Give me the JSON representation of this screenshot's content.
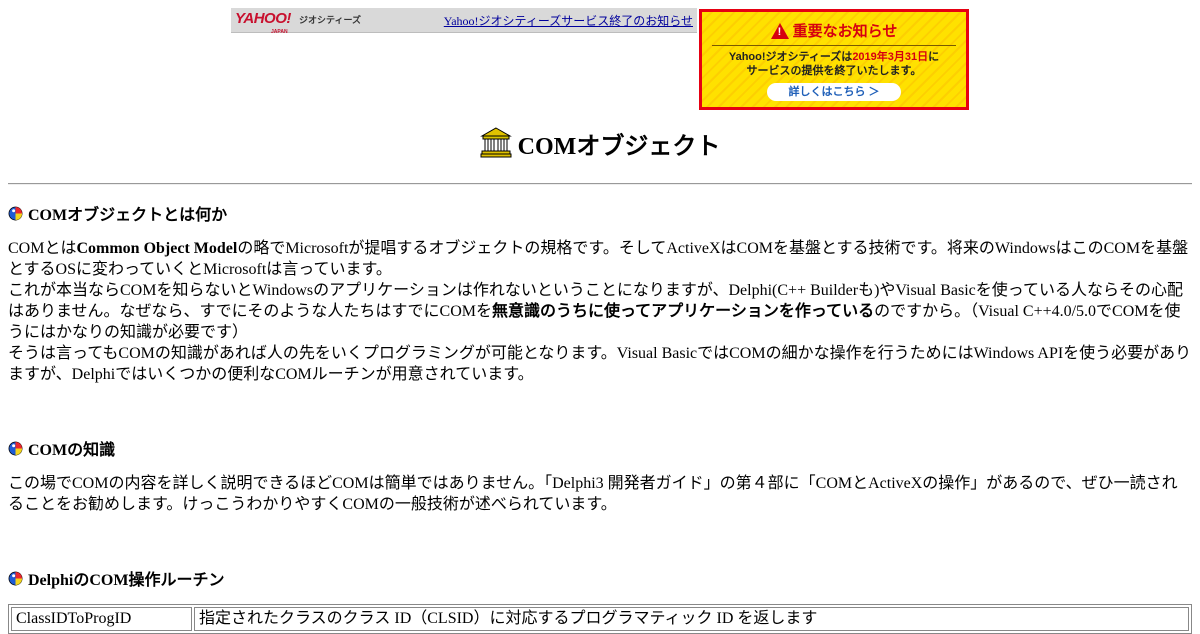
{
  "banner": {
    "yahoo_logo": "YAHOO!",
    "yahoo_japan": "JAPAN",
    "geo_label": "ジオシティーズ",
    "link_text": "Yahoo!ジオシティーズサービス終了のお知らせ"
  },
  "notice": {
    "title": "重要なお知らせ",
    "line1_prefix": "Yahoo!ジオシティーズは",
    "line1_date": "2019年3月31日",
    "line1_suffix": "に",
    "line2": "サービスの提供を終了いたします。",
    "button": "詳しくはこちら ＞",
    "colors": {
      "background": "#ffe100",
      "border": "#e60012",
      "accent": "#d60010"
    }
  },
  "page": {
    "title": "COMオブジェクト",
    "title_icon": "bank-building-icon"
  },
  "sections": [
    {
      "heading": "COMオブジェクトとは何か",
      "icon": "colored-ball-icon",
      "paragraphs": [
        {
          "a": "COMとは",
          "b": "Common Object Model",
          "c": "の略でMicrosoftが提唱するオブジェクトの規格です。そしてActiveXはCOMを基盤とする技術です。将来のWindowsはこのCOMを基盤とするOSに変わっていくとMicrosoftは言っています。"
        },
        {
          "a": "これが本当ならCOMを知らないとWindowsのアプリケーションは作れないということになりますが、Delphi(C++ Builderも)やVisual Basicを使っている人ならその心配はありません。なぜなら、すでにそのような人たちはすでにCOMを",
          "b": "無意識のうちに使ってアプリケーションを作っている",
          "c": "のですから。（Visual C++4.0/5.0でCOMを使うにはかなりの知識が必要です）"
        },
        {
          "a": "そうは言ってもCOMの知識があれば人の先をいくプログラミングが可能となります。Visual BasicではCOMの細かな操作を行うためにはWindows APIを使う必要がありますが、Delphiではいくつかの便利なCOMルーチンが用意されています。",
          "b": "",
          "c": ""
        }
      ]
    },
    {
      "heading": "COMの知識",
      "icon": "colored-ball-icon",
      "paragraphs": [
        {
          "a": "この場でCOMの内容を詳しく説明できるほどCOMは簡単ではありません。「Delphi3 開発者ガイド」の第４部に「COMとActiveXの操作」があるので、ぜひ一読されることをお勧めします。けっこうわかりやすくCOMの一般技術が述べられています。",
          "b": "",
          "c": ""
        }
      ]
    },
    {
      "heading": "DelphiのCOM操作ルーチン",
      "icon": "colored-ball-icon"
    }
  ],
  "routines_table": [
    {
      "name": "ClassIDToProgID",
      "description": "指定されたクラスのクラス ID（CLSID）に対応するプログラマティック ID を返します"
    }
  ]
}
